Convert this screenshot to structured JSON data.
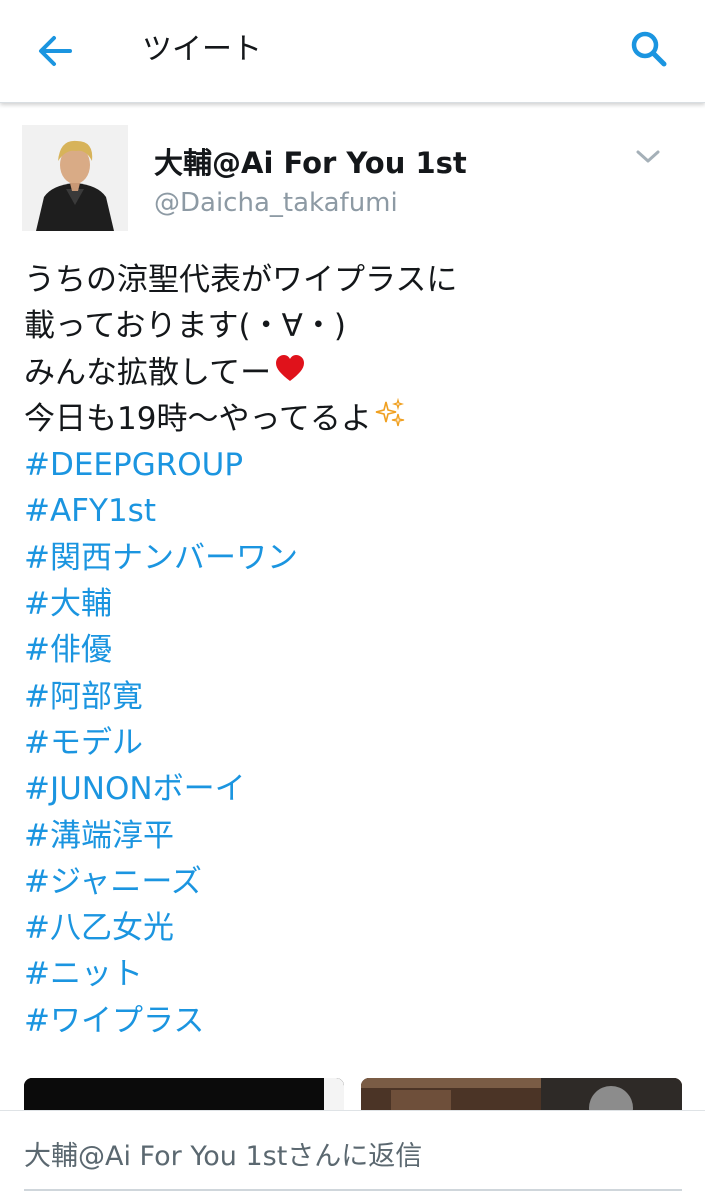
{
  "topbar": {
    "title": "ツイート",
    "back_icon": "arrow-left-icon",
    "search_icon": "search-icon",
    "accent_color": "#1b95e0"
  },
  "tweet": {
    "user": {
      "name": "大輔@Ai For You 1st",
      "handle": "@Daicha_takafumi",
      "avatar_icon": "user-avatar"
    },
    "menu_icon": "chevron-down-icon",
    "lines": [
      "うちの涼聖代表がワイプラスに",
      "載っております(・∀・)",
      "みんな拡散してー",
      "今日も19時〜やってるよ"
    ],
    "emojis": [
      "red-heart-icon",
      "sparkles-icon"
    ],
    "hashtags": [
      "#DEEPGROUP",
      "#AFY1st",
      "#関西ナンバーワン",
      "#大輔",
      "#俳優",
      "#阿部寛",
      "#モデル",
      "#JUNONボーイ",
      "#溝端淳平",
      "#ジャニーズ",
      "#八乙女光",
      "#ニット",
      "#ワイプラス"
    ],
    "hashtag_color": "#1b95e0"
  },
  "reply": {
    "placeholder": "大輔@Ai For You 1stさんに返信"
  }
}
